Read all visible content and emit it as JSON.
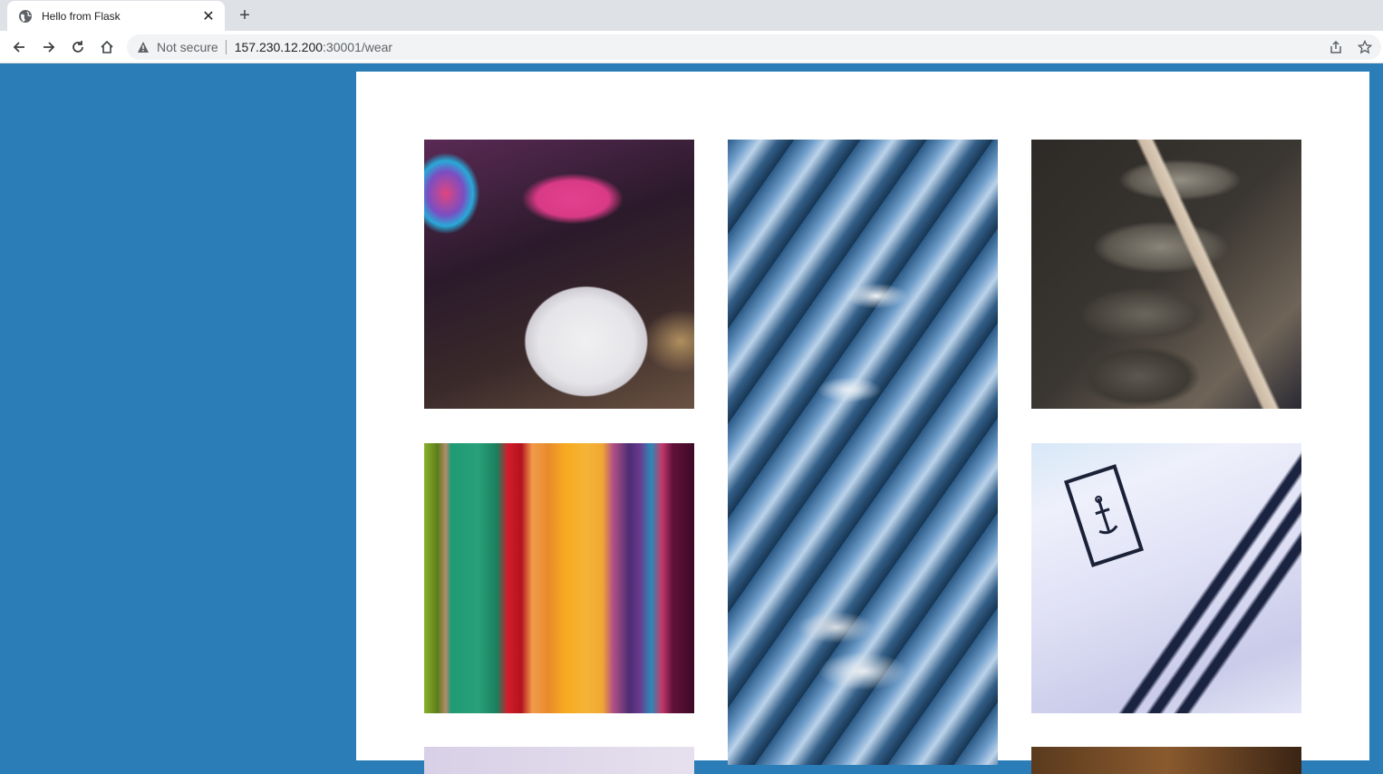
{
  "browser": {
    "tab_title": "Hello from Flask",
    "close_glyph": "✕",
    "new_tab_glyph": "+",
    "security_label": "Not secure",
    "url_host": "157.230.12.200",
    "url_path": ":30001/wear"
  },
  "colors": {
    "page_background": "#2b7db7",
    "panel_background": "#ffffff"
  },
  "gallery": {
    "images": [
      {
        "subject": "hats"
      },
      {
        "subject": "blurred-metal-hangers"
      },
      {
        "subject": "shoes-on-rack"
      },
      {
        "subject": "colorful-fabrics"
      },
      {
        "subject": "sailor-shirt"
      },
      {
        "subject": "partial-light"
      },
      {
        "subject": "partial-brown"
      }
    ]
  }
}
